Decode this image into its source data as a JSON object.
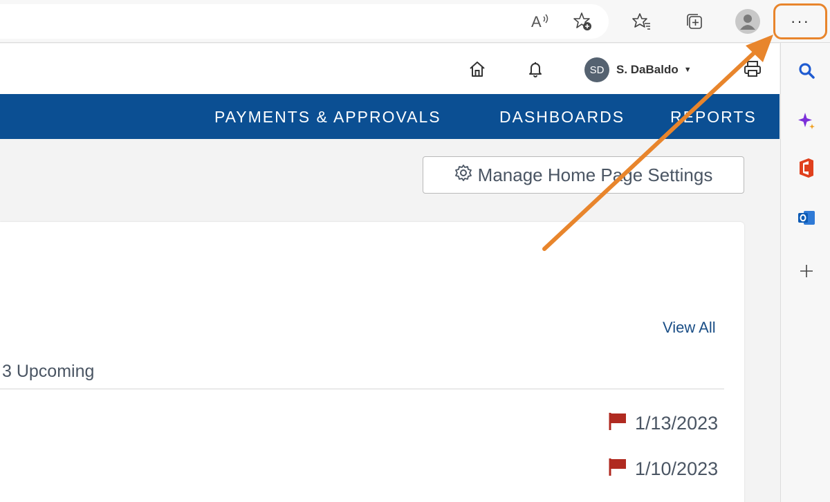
{
  "browser": {
    "read_aloud_icon": "read-aloud-icon",
    "more_label": "···"
  },
  "header": {
    "user": {
      "initials": "SD",
      "name": "S. DaBaldo"
    }
  },
  "nav": {
    "items": [
      "PAYMENTS & APPROVALS",
      "DASHBOARDS",
      "REPORTS"
    ]
  },
  "content": {
    "manage_button": "Manage Home Page Settings",
    "view_all": "View All",
    "upcoming": "3 Upcoming",
    "dates": [
      "1/13/2023",
      "1/10/2023"
    ]
  },
  "colors": {
    "nav_bg": "#0b4f93",
    "annotation": "#e8852c",
    "flag": "#b02a20"
  }
}
